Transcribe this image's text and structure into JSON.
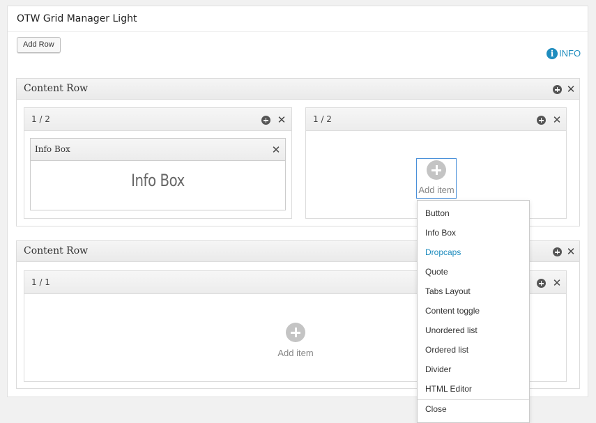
{
  "panel": {
    "title": "OTW Grid Manager Light",
    "add_row_label": "Add Row",
    "info_label": "INFO"
  },
  "rows": [
    {
      "title": "Content Row",
      "columns": [
        {
          "title": "1 / 2",
          "items": [
            {
              "title": "Info Box",
              "body": "Info Box"
            }
          ]
        },
        {
          "title": "1 / 2",
          "add_label": "Add item"
        }
      ]
    },
    {
      "title": "Content Row",
      "columns": [
        {
          "title": "1 / 1",
          "add_label": "Add item"
        }
      ]
    }
  ],
  "menu": {
    "items": [
      "Button",
      "Info Box",
      "Dropcaps",
      "Quote",
      "Tabs Layout",
      "Content toggle",
      "Unordered list",
      "Ordered list",
      "Divider",
      "HTML Editor"
    ],
    "hovered_item": "Dropcaps",
    "close_label": "Close"
  },
  "colors": {
    "link": "#1e8cbe",
    "active_border": "#4a90d9",
    "add_icon": "#c4c4c4"
  },
  "icons": {
    "add": "plus-circle-icon",
    "remove": "close-icon",
    "info": "info-circle-icon"
  }
}
